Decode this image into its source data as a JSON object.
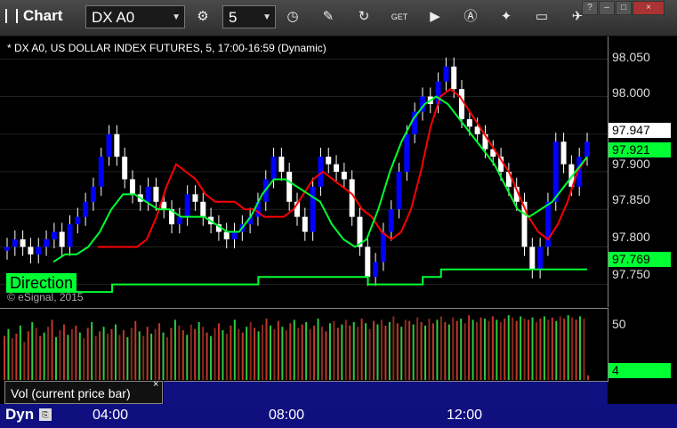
{
  "toolbar": {
    "title": "Chart",
    "symbol": "DX A0",
    "interval": "5",
    "icons": [
      "gear-icon",
      "clock-icon",
      "pencil-icon",
      "refresh-icon",
      "get-icon",
      "play-icon",
      "a-icon",
      "tools-icon",
      "comment-icon",
      "twitter-icon"
    ]
  },
  "window": {
    "help": "?",
    "minimize": "–",
    "restore": "□",
    "close": "×"
  },
  "chart": {
    "caption": "* DX A0, US DOLLAR INDEX FUTURES, 5, 17:00-16:59 (Dynamic)",
    "copyright": "© eSignal, 2015",
    "direction_label": "Direction",
    "price_labels": [
      "98.050",
      "98.000",
      "97.950",
      "97.900",
      "97.850",
      "97.800",
      "97.750"
    ],
    "last_price": "97.947",
    "green_tag": "97.921",
    "direction_tag": "97.769",
    "colors": {
      "up": "#0000ff",
      "down": "#ffffff",
      "ma_red": "#ff0000",
      "ma_green": "#00ff33",
      "direction": "#00ff33"
    }
  },
  "volume": {
    "label": "Vol (current price bar)",
    "close": "×",
    "scale_label": "50",
    "current": "4"
  },
  "timeaxis": {
    "mode": "Dyn",
    "labels": [
      "04:00",
      "08:00",
      "12:00"
    ]
  },
  "chart_data": {
    "type": "line",
    "ylim": [
      97.72,
      98.08
    ],
    "price_series_close": [
      97.8,
      97.81,
      97.8,
      97.79,
      97.8,
      97.81,
      97.82,
      97.8,
      97.83,
      97.84,
      97.86,
      97.88,
      97.92,
      97.95,
      97.92,
      97.89,
      97.87,
      97.86,
      97.88,
      97.86,
      97.85,
      97.83,
      97.84,
      97.87,
      97.86,
      97.84,
      97.83,
      97.82,
      97.81,
      97.82,
      97.83,
      97.84,
      97.86,
      97.89,
      97.92,
      97.9,
      97.86,
      97.84,
      97.82,
      97.88,
      97.92,
      97.91,
      97.9,
      97.89,
      97.84,
      97.8,
      97.76,
      97.78,
      97.82,
      97.85,
      97.9,
      97.95,
      97.98,
      98.0,
      97.99,
      98.02,
      98.04,
      98.01,
      97.97,
      97.96,
      97.95,
      97.93,
      97.92,
      97.9,
      97.88,
      97.86,
      97.8,
      97.77,
      97.8,
      97.86,
      97.94,
      97.91,
      97.88,
      97.92,
      97.94
    ],
    "ma_fast": [
      97.8,
      97.8,
      97.8,
      97.8,
      97.8,
      97.81,
      97.84,
      97.88,
      97.91,
      97.9,
      97.89,
      97.87,
      97.86,
      97.86,
      97.86,
      97.85,
      97.85,
      97.84,
      97.84,
      97.84,
      97.85,
      97.87,
      97.89,
      97.9,
      97.89,
      97.88,
      97.87,
      97.85,
      97.84,
      97.82,
      97.81,
      97.82,
      97.85,
      97.9,
      97.96,
      98.0,
      98.01,
      98.0,
      97.98,
      97.96,
      97.94,
      97.92,
      97.9,
      97.87,
      97.84,
      97.82,
      97.81,
      97.83,
      97.86,
      97.9,
      97.92
    ],
    "ma_slow": [
      97.78,
      97.79,
      97.79,
      97.8,
      97.82,
      97.85,
      97.87,
      97.87,
      97.86,
      97.85,
      97.85,
      97.84,
      97.84,
      97.84,
      97.83,
      97.82,
      97.82,
      97.84,
      97.87,
      97.89,
      97.89,
      97.88,
      97.87,
      97.86,
      97.83,
      97.81,
      97.8,
      97.81,
      97.85,
      97.9,
      97.94,
      97.97,
      97.99,
      98.0,
      97.99,
      97.97,
      97.95,
      97.93,
      97.91,
      97.88,
      97.85,
      97.84,
      97.85,
      97.86,
      97.88,
      97.9,
      97.92
    ],
    "direction": [
      97.74,
      97.74,
      97.75,
      97.75,
      97.75,
      97.75,
      97.75,
      97.75,
      97.75,
      97.75,
      97.76,
      97.76,
      97.76,
      97.76,
      97.76,
      97.76,
      97.75,
      97.75,
      97.75,
      97.76,
      97.77,
      97.77,
      97.77,
      97.77,
      97.77,
      97.77,
      97.77,
      97.77,
      97.77
    ],
    "volume": [
      38,
      44,
      36,
      40,
      47,
      33,
      42,
      50,
      45,
      38,
      41,
      46,
      52,
      37,
      43,
      48,
      39,
      44,
      47,
      41,
      36,
      45,
      50,
      38,
      42,
      46,
      40,
      44,
      48,
      39,
      43,
      37,
      45,
      51,
      42,
      38,
      46,
      40,
      44,
      49,
      41,
      37,
      45,
      52,
      47,
      43,
      39,
      48,
      44,
      50,
      46,
      41,
      38,
      45,
      49,
      43,
      40,
      47,
      52,
      44,
      41,
      46,
      50,
      45,
      42,
      48,
      53,
      47,
      44,
      51,
      46,
      43,
      49,
      52,
      45,
      48,
      50,
      44,
      47,
      53,
      46,
      42,
      49,
      51,
      45,
      48,
      52,
      47,
      50,
      46,
      53,
      49,
      44,
      51,
      48,
      52,
      47,
      50,
      55,
      49,
      46,
      52,
      51,
      48,
      54,
      50,
      47,
      53,
      49,
      52,
      55,
      50,
      48,
      54,
      51,
      53,
      49,
      56,
      52,
      50,
      54,
      53,
      51,
      55,
      52,
      50,
      53,
      56,
      54,
      51,
      55,
      53,
      52,
      54,
      50,
      53,
      55,
      52,
      54,
      51,
      55,
      53,
      56,
      54,
      52,
      55,
      53,
      4
    ]
  }
}
